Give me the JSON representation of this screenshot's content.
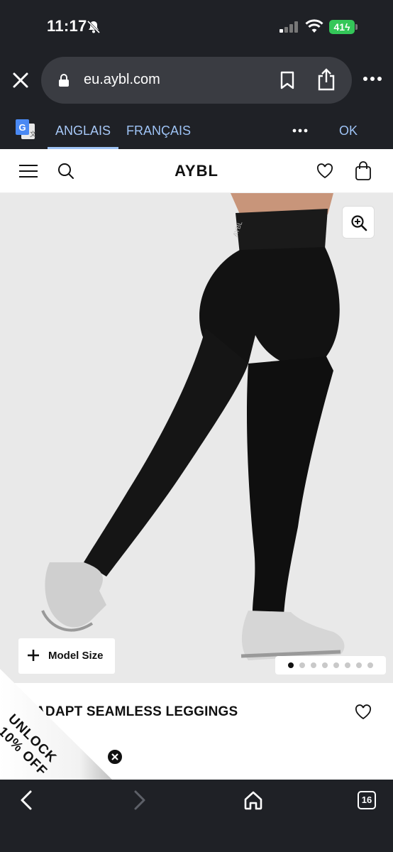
{
  "status_bar": {
    "time": "11:17",
    "battery": "41",
    "icons": [
      "bell-slash-icon",
      "signal-icon",
      "wifi-icon",
      "battery-charging-icon"
    ]
  },
  "browser": {
    "url": "eu.aybl.com",
    "icons": [
      "close-icon",
      "lock-icon",
      "bookmark-icon",
      "share-icon",
      "more-icon"
    ]
  },
  "translate_bar": {
    "source_lang": "ANGLAIS",
    "target_lang": "FRANÇAIS",
    "ok_label": "OK",
    "accent": "#9ec3f5"
  },
  "site_header": {
    "logo": "AYBL",
    "icons": [
      "menu-icon",
      "search-icon",
      "heart-icon",
      "bag-icon"
    ]
  },
  "product": {
    "model_size_label": "Model Size",
    "title": "ADAPT SEAMLESS LEGGINGS",
    "gallery_count": 8,
    "gallery_active": 1
  },
  "promo": {
    "line1": "UNLOCK",
    "line2": "10% OFF"
  },
  "toolbar": {
    "tabs_count": "16",
    "icons": [
      "back-icon",
      "forward-icon",
      "home-icon",
      "tabs-icon"
    ]
  }
}
